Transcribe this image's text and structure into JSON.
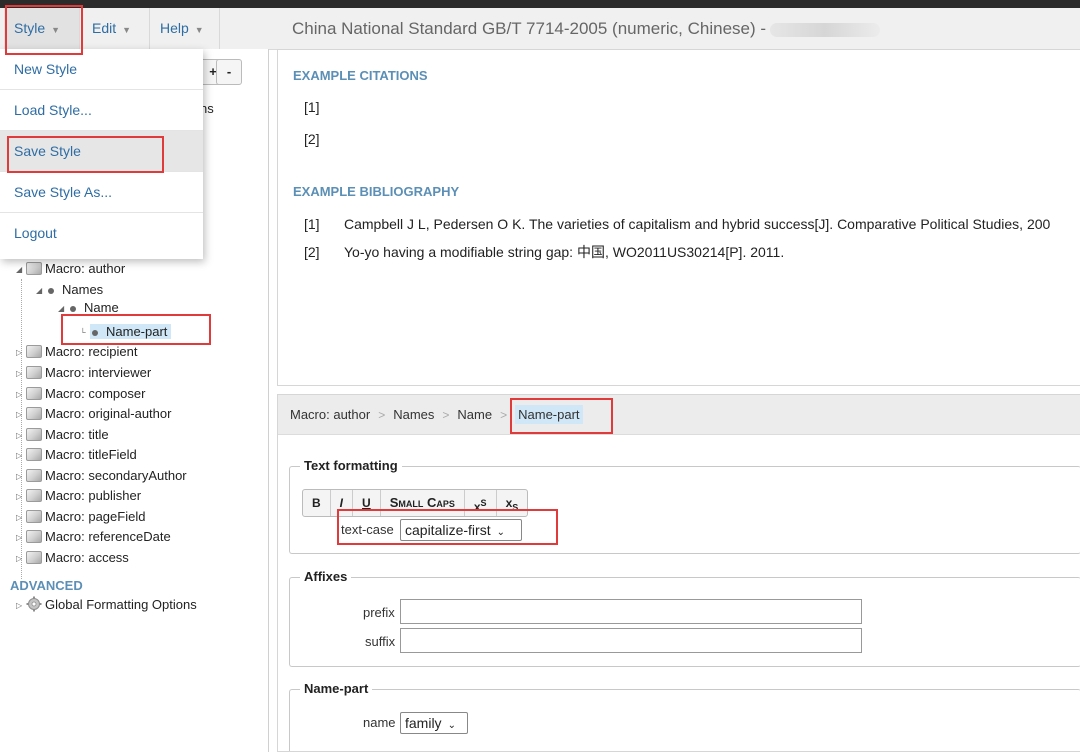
{
  "menubar": {
    "style_label": "Style",
    "edit_label": "Edit",
    "help_label": "Help",
    "window_title": "China National Standard GB/T 7714-2005 (numeric, Chinese) -"
  },
  "style_menu": {
    "items": [
      "New Style",
      "Load Style...",
      "Save Style",
      "Save Style As...",
      "Logout"
    ],
    "active_index": 2
  },
  "tree": {
    "controls": [
      "+",
      "-"
    ],
    "peek_text": "ns",
    "nodes": {
      "macro_author": "Macro: author",
      "names": "Names",
      "name": "Name",
      "name_part": "Name-part",
      "recipient": "Macro: recipient",
      "interviewer": "Macro: interviewer",
      "composer": "Macro: composer",
      "original_author": "Macro: original-author",
      "title": "Macro: title",
      "titlefield": "Macro: titleField",
      "secondary_author": "Macro: secondaryAuthor",
      "publisher": "Macro: publisher",
      "pagefield": "Macro: pageField",
      "reference_date": "Macro: referenceDate",
      "access": "Macro: access"
    },
    "advanced_heading": "ADVANCED",
    "global_formatting": "Global Formatting Options"
  },
  "examples": {
    "citations_heading": "EXAMPLE CITATIONS",
    "citations": [
      "[1]",
      "[2]"
    ],
    "bibliography_heading": "EXAMPLE BIBLIOGRAPHY",
    "bibliography": [
      {
        "num": "[1]",
        "text": "Campbell J L, Pedersen O K. The varieties of capitalism and hybrid success[J]. Comparative Political Studies, 200"
      },
      {
        "num": "[2]",
        "text": "Yo-yo having a modifiable string gap: 中国, WO2011US30214[P]. 2011."
      }
    ]
  },
  "breadcrumb": [
    "Macro: author",
    "Names",
    "Name",
    "Name-part"
  ],
  "breadcrumb_sep": ">",
  "text_formatting": {
    "legend": "Text formatting",
    "buttons": {
      "bold": "B",
      "italic": "I",
      "underline": "U",
      "small_caps": "Small Caps",
      "superscript": "x",
      "subscript": "x"
    },
    "text_case_label": "text-case",
    "text_case_value": "capitalize-first"
  },
  "affixes": {
    "legend": "Affixes",
    "prefix_label": "prefix",
    "suffix_label": "suffix",
    "prefix_value": "",
    "suffix_value": ""
  },
  "name_part_group": {
    "legend": "Name-part",
    "name_label": "name",
    "name_value": "family"
  },
  "colors": {
    "accent": "#2e6da4",
    "heading": "#5b8fb5",
    "selection": "#cfe7f7",
    "annotation": "#e13a3a"
  }
}
